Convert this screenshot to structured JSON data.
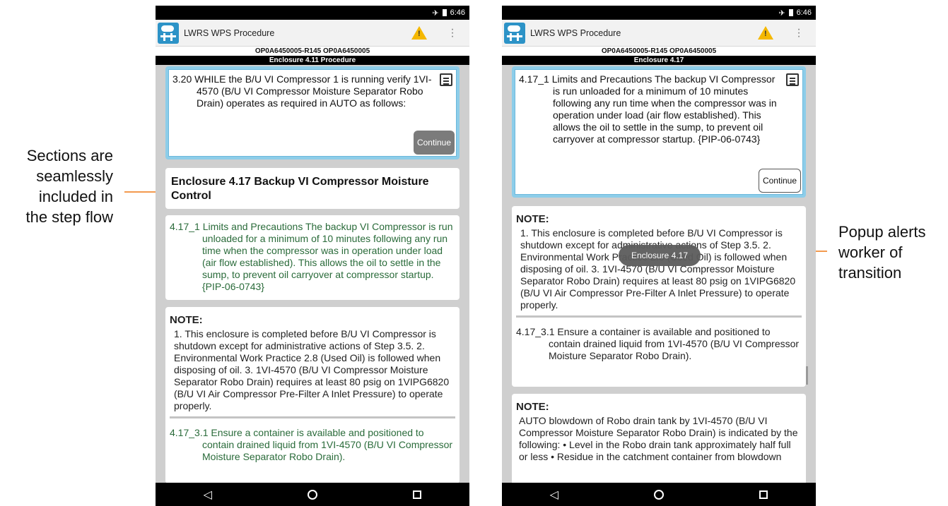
{
  "annotations": {
    "left": [
      "Sections are",
      "seamlessly",
      "included in",
      "the step flow"
    ],
    "right": [
      "Popup alerts",
      "worker of",
      "transition"
    ],
    "arrow_color": "#f39a4e"
  },
  "status": {
    "time": "6:46",
    "airplane_icon": "airplane-icon",
    "battery_icon": "battery-icon"
  },
  "app": {
    "title": "LWRS WPS Procedure",
    "logo_icon": "app-logo-icon",
    "warning_icon": "warning-icon"
  },
  "left_screen": {
    "doc_id": "OP0A6450005-R145 OP0A6450005",
    "section": "Enclosure 4.11 Procedure",
    "step": {
      "number": "3.20",
      "text": "WHILE the B/U VI Compressor 1 is running verify 1VI-4570 (B/U VI Compressor Moisture Separator Robo Drain) operates as required in AUTO as follows:",
      "continue": "Continue"
    },
    "enclosure_heading": "Enclosure 4.17 Backup VI Compressor Moisture Control",
    "limits": "4.17_1 Limits and Precautions The backup VI Compressor is run unloaded for a minimum of 10 minutes following any run time when the compressor was in operation under load (air flow established). This allows the oil to settle in the sump, to prevent oil carryover at compressor startup. {PIP-06-0743}",
    "note_title": "NOTE:",
    "note_body": "1. This enclosure is completed before B/U VI Compressor is shutdown except for administrative actions of Step 3.5. 2. Environmental Work Practice 2.8 (Used Oil) is followed when disposing of oil. 3. 1VI-4570 (B/U VI Compressor Moisture Separator Robo Drain) requires at least 80 psig on 1VIPG6820 (B/U VI Air Compressor Pre-Filter A Inlet Pressure) to operate properly.",
    "substep": "4.17_3.1 Ensure a container is available and positioned to contain drained liquid from 1VI-4570 (B/U VI Compressor Moisture Separator Robo Drain)."
  },
  "right_screen": {
    "doc_id": "OP0A6450005-R145 OP0A6450005",
    "section": "Enclosure 4.17",
    "step": {
      "text": "4.17_1 Limits and Precautions The backup VI Compressor is run unloaded for a minimum of 10 minutes following any run time when the compressor was in operation under load (air flow established). This allows the oil to settle in the sump, to prevent oil carryover at compressor startup. {PIP-06-0743}",
      "continue": "Continue"
    },
    "note_title": "NOTE:",
    "note_body": "1. This enclosure is completed before B/U VI Compressor is shutdown except for administrative actions of Step 3.5. 2. Environmental Work Practice 2.8 (Used Oil) is followed when disposing of oil. 3. 1VI-4570 (B/U VI Compressor Moisture Separator Robo Drain) requires at least 80 psig on 1VIPG6820 (B/U VI Air Compressor Pre-Filter A Inlet Pressure) to operate properly.",
    "substep": "4.17_3.1 Ensure a container is available and positioned to contain drained liquid from 1VI-4570 (B/U VI Compressor Moisture Separator Robo Drain).",
    "note2_title": "NOTE:",
    "note2_body": "AUTO blowdown of Robo drain tank by 1VI-4570 (B/U VI Compressor Moisture Separator Robo Drain) is indicated by the following: • Level in the Robo drain tank approximately half full or less • Residue in the catchment container from blowdown",
    "toast": "Enclosure 4.17"
  },
  "navbar": {
    "back_icon": "back-icon",
    "home_icon": "home-icon",
    "recents_icon": "recents-icon"
  }
}
